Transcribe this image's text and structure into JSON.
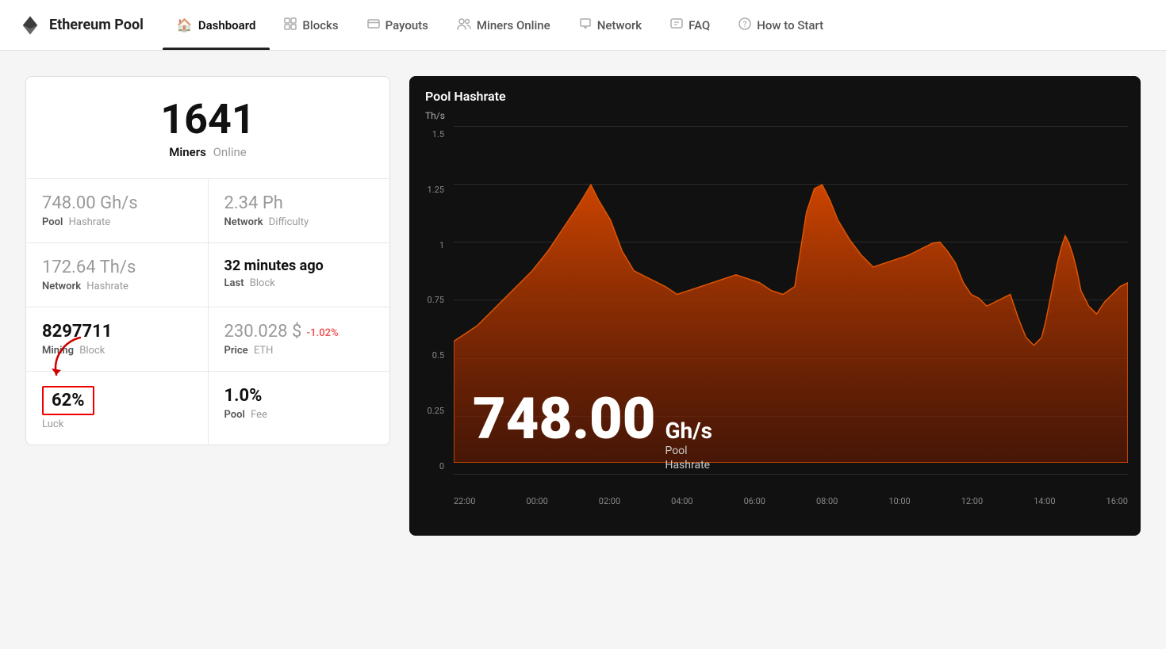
{
  "brand": {
    "title": "Ethereum Pool",
    "icon_unicode": "⬡"
  },
  "nav": {
    "items": [
      {
        "label": "Dashboard",
        "icon": "⌂",
        "active": true
      },
      {
        "label": "Blocks",
        "icon": "◫",
        "active": false
      },
      {
        "label": "Payouts",
        "icon": "▣",
        "active": false
      },
      {
        "label": "Miners Online",
        "icon": "👥",
        "active": false
      },
      {
        "label": "Network",
        "icon": "🖥",
        "active": false
      },
      {
        "label": "FAQ",
        "icon": "💬",
        "active": false
      },
      {
        "label": "How to Start",
        "icon": "?",
        "active": false
      }
    ]
  },
  "stats": {
    "miners_online": "1641",
    "miners_label_black": "Miners",
    "miners_label_grey": "Online",
    "pool_hashrate_value": "748.00",
    "pool_hashrate_unit": " Gh/s",
    "pool_hashrate_label_black": "Pool",
    "pool_hashrate_label_grey": "Hashrate",
    "network_difficulty_value": "2.34",
    "network_difficulty_unit": " Ph",
    "network_difficulty_label_black": "Network",
    "network_difficulty_label_grey": "Difficulty",
    "network_hashrate_value": "172.64",
    "network_hashrate_unit": " Th/s",
    "network_hashrate_label_black": "Network",
    "network_hashrate_label_grey": "Hashrate",
    "last_block": "32 minutes ago",
    "last_block_label_black": "Last",
    "last_block_label_grey": "Block",
    "mining_block": "8297711",
    "mining_block_label_black": "Mining",
    "mining_block_label_grey": "Block",
    "price_value": "230.028",
    "price_unit": " $",
    "price_change": "-1.02%",
    "price_label_black": "Price",
    "price_label_grey": "ETH",
    "luck": "62%",
    "luck_label": "Luck",
    "pool_fee": "1.0%",
    "pool_fee_label_black": "Pool",
    "pool_fee_label_grey": "Fee"
  },
  "chart": {
    "title": "Pool Hashrate",
    "unit": "Th/s",
    "hashrate_display": "748.00",
    "hashrate_unit": "Gh/s",
    "hashrate_sublabel": "Pool\nHashrate",
    "y_labels": [
      "0",
      "0.25",
      "0.5",
      "0.75",
      "1",
      "1.25",
      "1.5"
    ],
    "x_labels": [
      "22:00",
      "00:00",
      "02:00",
      "04:00",
      "06:00",
      "08:00",
      "10:00",
      "12:00",
      "14:00",
      "16:00"
    ]
  }
}
